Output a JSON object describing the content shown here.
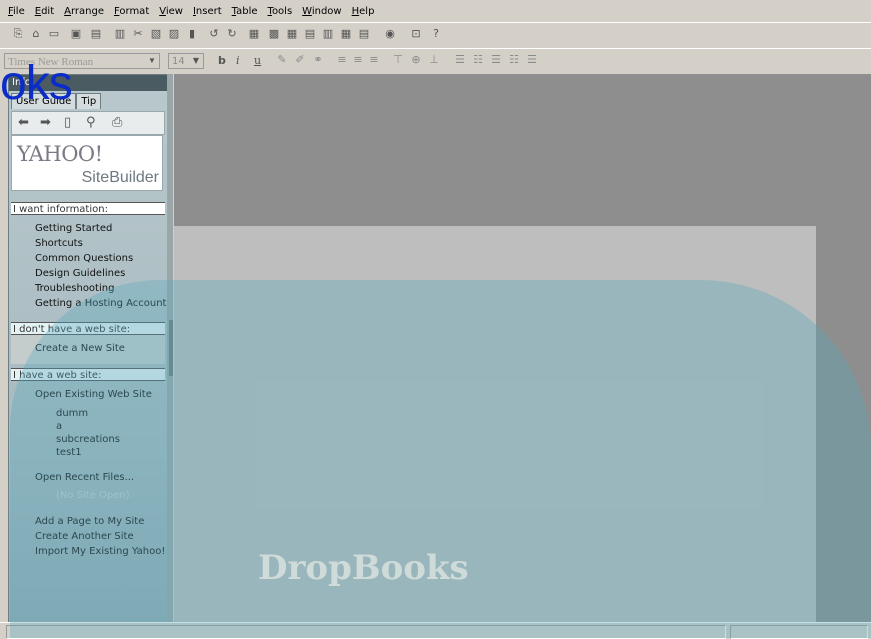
{
  "menu": [
    "File",
    "Edit",
    "Arrange",
    "Format",
    "View",
    "Insert",
    "Table",
    "Tools",
    "Window",
    "Help"
  ],
  "format_bar": {
    "font": "Times New Roman",
    "size": "14",
    "bold": "b",
    "italic": "i",
    "underline": "u"
  },
  "panel": {
    "title": "Info",
    "tabs": [
      "User Guide",
      "Tip"
    ],
    "logo_main": "YAHOO!",
    "logo_sub": "SiteBuilder",
    "section_info": "I want information:",
    "info_links": [
      "Getting Started",
      "Shortcuts",
      "Common Questions",
      "Design Guidelines",
      "Troubleshooting",
      "Getting a Hosting Account"
    ],
    "section_nosite": "I don't have a web site:",
    "create_new_site": "Create a New Site",
    "section_havesite": "I have a web site:",
    "open_existing": "Open Existing Web Site",
    "sites": [
      "dumm",
      "a",
      "subcreations",
      "test1"
    ],
    "open_recent": "Open Recent Files...",
    "no_site_open": "(No Site Open)",
    "actions": [
      "Add a Page to My Site",
      "Create Another Site",
      "Import My Existing Yahoo!"
    ]
  },
  "watermark": {
    "text": "DropBooks",
    "corner": "oks"
  },
  "icons": {
    "toolbar1": [
      "new-site-icon",
      "new-page-icon",
      "open-icon",
      "save-icon",
      "save-all-icon",
      "publish-icon",
      "cut-icon",
      "copy-icon",
      "paste-icon",
      "delete-icon",
      "undo-icon",
      "redo-icon",
      "text-box-icon",
      "image-icon",
      "table-icon",
      "form-icon",
      "media-icon",
      "layer-icon",
      "page-icon",
      "preview-icon",
      "upload-icon",
      "help-icon"
    ],
    "toolbar2": [
      "bold-icon",
      "italic-icon",
      "underline-icon",
      "text-color-icon",
      "highlight-icon",
      "link-icon",
      "align-left-icon",
      "align-center-icon",
      "align-right-icon",
      "valign-top-icon",
      "valign-middle-icon",
      "valign-bottom-icon",
      "bullets-icon",
      "numbering-icon",
      "indent-icon",
      "outdent-icon",
      "list-icon"
    ],
    "nav": [
      "back-icon",
      "forward-icon",
      "home-icon",
      "search-icon",
      "print-icon"
    ]
  }
}
